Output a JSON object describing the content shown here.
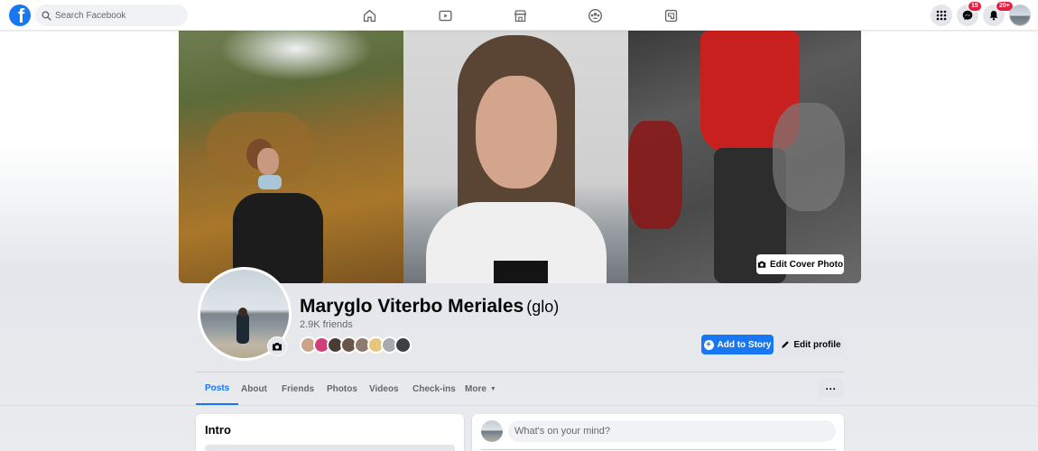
{
  "topbar": {
    "logo_letter": "f",
    "search_placeholder": "Search Facebook",
    "nav_icons": [
      "home-icon",
      "watch-icon",
      "marketplace-icon",
      "groups-icon",
      "gaming-icon"
    ],
    "right_icons": [
      "menu-grid-icon",
      "messenger-icon",
      "notifications-icon",
      "account-avatar"
    ],
    "messenger_badge": "15",
    "notifications_badge": "20+"
  },
  "cover": {
    "edit_cover_label": "Edit Cover Photo"
  },
  "profile": {
    "name": "Maryglo Viterbo Meriales",
    "alternate_name": "(glo)",
    "friends_count": "2.9K friends",
    "add_story_label": "Add to Story",
    "edit_profile_label": "Edit profile"
  },
  "tabs": [
    {
      "label": "Posts",
      "active": true
    },
    {
      "label": "About"
    },
    {
      "label": "Friends"
    },
    {
      "label": "Photos"
    },
    {
      "label": "Videos"
    },
    {
      "label": "Check-ins"
    },
    {
      "label": "More"
    }
  ],
  "more_dots_label": "···",
  "intro": {
    "title": "Intro"
  },
  "composer": {
    "placeholder": "What's on your mind?"
  },
  "colors": {
    "brand_blue": "#1877f2",
    "badge_red": "#e41e3f",
    "secondary_button": "#e4e6eb",
    "page_background": "#f0f2f5"
  }
}
